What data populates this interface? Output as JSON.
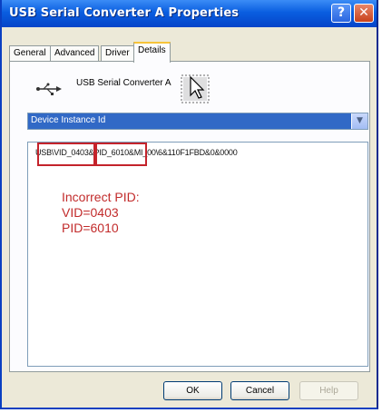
{
  "window": {
    "title": "USB Serial Converter A Properties"
  },
  "title_buttons": {
    "help": "?",
    "close": "✕"
  },
  "tabs": [
    {
      "label": "General"
    },
    {
      "label": "Advanced"
    },
    {
      "label": "Driver"
    },
    {
      "label": "Details"
    }
  ],
  "details": {
    "device_name": "USB Serial Converter A",
    "property_select": "Device Instance Id",
    "value_parts": [
      "US",
      "B\\VID_0403",
      "&",
      "PID_6010",
      "&",
      "MI_00\\6&110F1FBD&0&0000"
    ]
  },
  "annotation": {
    "lines": [
      "Incorrect PID:",
      "VID=0403",
      "PID=6010"
    ],
    "color": "#c4232b"
  },
  "buttons": {
    "ok": "OK",
    "cancel": "Cancel",
    "help": "Help"
  }
}
